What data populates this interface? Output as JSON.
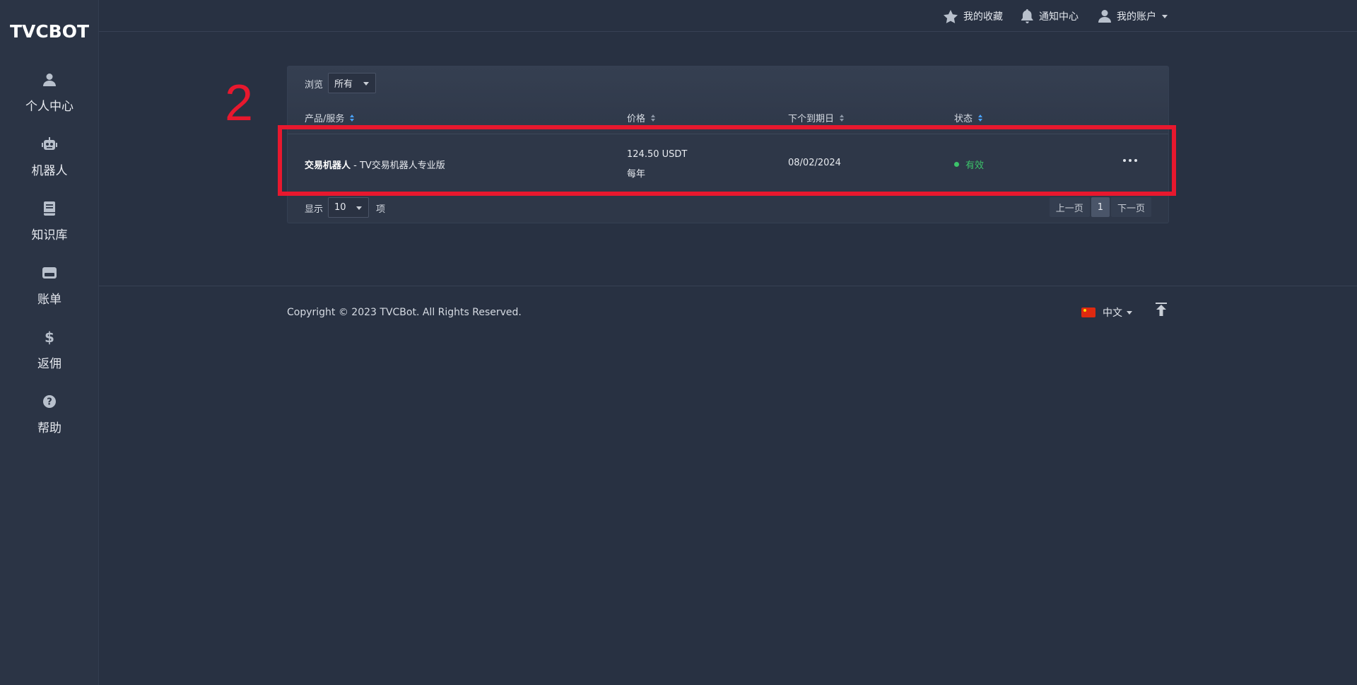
{
  "app": {
    "logo": "TVCBOT"
  },
  "sidebar": {
    "items": [
      {
        "label": "个人中心",
        "icon": "user-icon"
      },
      {
        "label": "机器人",
        "icon": "robot-icon"
      },
      {
        "label": "知识库",
        "icon": "book-icon"
      },
      {
        "label": "账单",
        "icon": "billing-icon"
      },
      {
        "label": "返佣",
        "icon": "dollar-icon"
      },
      {
        "label": "帮助",
        "icon": "help-icon"
      }
    ]
  },
  "topbar": {
    "favorites": "我的收藏",
    "notifications": "通知中心",
    "account": "我的账户"
  },
  "panel": {
    "browse_label": "浏览",
    "browse_value": "所有",
    "columns": [
      "产品/服务",
      "价格",
      "下个到期日",
      "状态"
    ],
    "rows": [
      {
        "product_name": "交易机器人",
        "product_suffix": " - TV交易机器人专业版",
        "price": "124.50 USDT",
        "cycle": "每年",
        "due_date": "08/02/2024",
        "status": "有效"
      }
    ],
    "show_prefix": "显示",
    "show_value": "10",
    "show_suffix": "项",
    "pager": {
      "prev": "上一页",
      "current": "1",
      "next": "下一页"
    }
  },
  "annotation": {
    "number": "2",
    "color": "#e8182e"
  },
  "footer": {
    "copyright": "Copyright © 2023 TVCBot. All Rights Reserved.",
    "language": "中文"
  },
  "colors": {
    "background": "#283142",
    "active": "#3cc36a",
    "sort_accent": "#4aa3ff"
  }
}
